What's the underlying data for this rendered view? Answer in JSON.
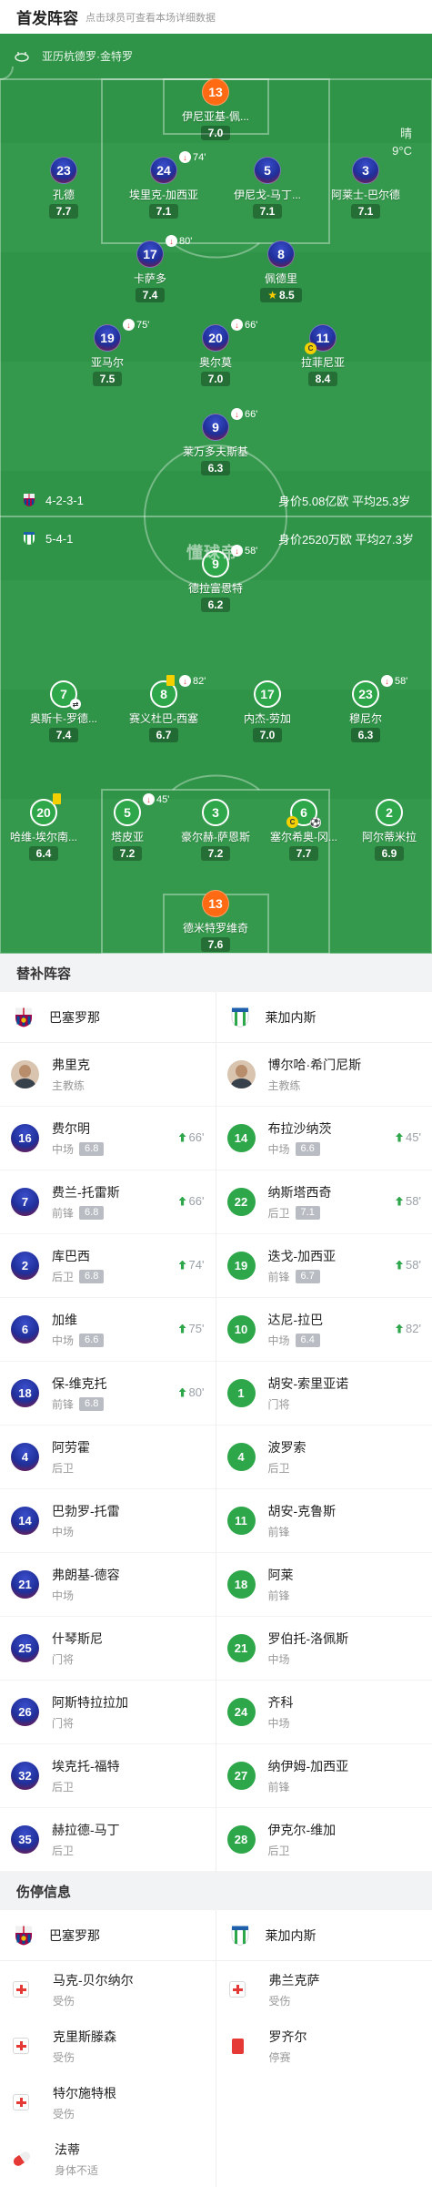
{
  "header": {
    "title": "首发阵容",
    "hint": "点击球员可查看本场详细数据"
  },
  "match": {
    "stadium": "亚历杭德罗·金特罗",
    "weather": "晴",
    "temperature": "9°C",
    "watermark": "懂球帝"
  },
  "teams": {
    "barca": {
      "name": "巴塞罗那",
      "formation": "4-2-3-1",
      "value": "身价5.08亿欧",
      "avg_age": "平均25.3岁"
    },
    "leganes": {
      "name": "莱加内斯",
      "formation": "5-4-1",
      "value": "身价2520万欧",
      "avg_age": "平均27.3岁"
    }
  },
  "lineup_barca": [
    {
      "num": "13",
      "name": "伊尼亚基-佩...",
      "rating": "7.0",
      "kit": "gk-barca"
    },
    {
      "num": "23",
      "name": "孔德",
      "rating": "7.7",
      "kit": "barca"
    },
    {
      "num": "24",
      "name": "埃里克-加西亚",
      "rating": "7.1",
      "kit": "barca",
      "sub": "74'"
    },
    {
      "num": "5",
      "name": "伊尼戈-马丁...",
      "rating": "7.1",
      "kit": "barca"
    },
    {
      "num": "3",
      "name": "阿莱士-巴尔德",
      "rating": "7.1",
      "kit": "barca"
    },
    {
      "num": "17",
      "name": "卡萨多",
      "rating": "7.4",
      "kit": "barca",
      "sub": "80'"
    },
    {
      "num": "8",
      "name": "佩德里",
      "rating": "8.5",
      "kit": "barca",
      "star": true
    },
    {
      "num": "19",
      "name": "亚马尔",
      "rating": "7.5",
      "kit": "barca",
      "sub": "75'"
    },
    {
      "num": "20",
      "name": "奥尔莫",
      "rating": "7.0",
      "kit": "barca",
      "sub": "66'"
    },
    {
      "num": "11",
      "name": "拉菲尼亚",
      "rating": "8.4",
      "kit": "barca",
      "captain": "C"
    },
    {
      "num": "9",
      "name": "莱万多夫斯基",
      "rating": "6.3",
      "kit": "barca",
      "sub": "66'"
    }
  ],
  "lineup_leganes": [
    {
      "num": "9",
      "name": "德拉富恩特",
      "rating": "6.2",
      "kit": "leg",
      "sub": "58'"
    },
    {
      "num": "7",
      "name": "奥斯卡-罗德...",
      "rating": "7.4",
      "kit": "leg",
      "sub_icon": true
    },
    {
      "num": "8",
      "name": "赛义杜巴-西塞",
      "rating": "6.7",
      "kit": "leg",
      "sub": "82'",
      "yellow": true
    },
    {
      "num": "17",
      "name": "内杰-劳加",
      "rating": "7.0",
      "kit": "leg"
    },
    {
      "num": "23",
      "name": "穆尼尔",
      "rating": "6.3",
      "kit": "leg",
      "sub": "58'"
    },
    {
      "num": "20",
      "name": "哈维-埃尔南...",
      "rating": "6.4",
      "kit": "leg",
      "yellow": true
    },
    {
      "num": "5",
      "name": "塔皮亚",
      "rating": "7.2",
      "kit": "leg",
      "sub": "45'"
    },
    {
      "num": "3",
      "name": "豪尔赫-萨恩斯",
      "rating": "7.2",
      "kit": "leg"
    },
    {
      "num": "6",
      "name": "塞尔希奥-冈...",
      "rating": "7.7",
      "kit": "leg",
      "captain": "C",
      "goal": true
    },
    {
      "num": "2",
      "name": "阿尔蒂米拉",
      "rating": "6.9",
      "kit": "leg"
    },
    {
      "num": "13",
      "name": "德米特罗维奇",
      "rating": "7.6",
      "kit": "gk-leg"
    }
  ],
  "subs": {
    "title": "替补阵容",
    "barca_coach": {
      "name": "弗里克",
      "role": "主教练"
    },
    "leganes_coach": {
      "name": "博尔哈·希门尼斯",
      "role": "主教练"
    },
    "barca": [
      {
        "num": "16",
        "name": "费尔明",
        "pos": "中场",
        "rating": "6.8",
        "in": "66'"
      },
      {
        "num": "7",
        "name": "费兰-托雷斯",
        "pos": "前锋",
        "rating": "6.8",
        "in": "66'"
      },
      {
        "num": "2",
        "name": "库巴西",
        "pos": "后卫",
        "rating": "6.8",
        "in": "74'"
      },
      {
        "num": "6",
        "name": "加维",
        "pos": "中场",
        "rating": "6.6",
        "in": "75'"
      },
      {
        "num": "18",
        "name": "保-维克托",
        "pos": "前锋",
        "rating": "6.8",
        "in": "80'"
      },
      {
        "num": "4",
        "name": "阿劳霍",
        "pos": "后卫"
      },
      {
        "num": "14",
        "name": "巴勃罗-托雷",
        "pos": "中场"
      },
      {
        "num": "21",
        "name": "弗朗基-德容",
        "pos": "中场"
      },
      {
        "num": "25",
        "name": "什琴斯尼",
        "pos": "门将"
      },
      {
        "num": "26",
        "name": "阿斯特拉拉加",
        "pos": "门将"
      },
      {
        "num": "32",
        "name": "埃克托-福特",
        "pos": "后卫"
      },
      {
        "num": "35",
        "name": "赫拉德-马丁",
        "pos": "后卫"
      }
    ],
    "leganes": [
      {
        "num": "14",
        "name": "布拉沙纳茨",
        "pos": "中场",
        "rating": "6.6",
        "in": "45'"
      },
      {
        "num": "22",
        "name": "纳斯塔西奇",
        "pos": "后卫",
        "rating": "7.1",
        "in": "58'"
      },
      {
        "num": "19",
        "name": "迭戈-加西亚",
        "pos": "前锋",
        "rating": "6.7",
        "in": "58'"
      },
      {
        "num": "10",
        "name": "达尼-拉巴",
        "pos": "中场",
        "rating": "6.4",
        "in": "82'"
      },
      {
        "num": "1",
        "name": "胡安-索里亚诺",
        "pos": "门将"
      },
      {
        "num": "4",
        "name": "波罗索",
        "pos": "后卫"
      },
      {
        "num": "11",
        "name": "胡安-克鲁斯",
        "pos": "前锋"
      },
      {
        "num": "18",
        "name": "阿莱",
        "pos": "前锋"
      },
      {
        "num": "21",
        "name": "罗伯托-洛佩斯",
        "pos": "中场"
      },
      {
        "num": "24",
        "name": "齐科",
        "pos": "中场"
      },
      {
        "num": "27",
        "name": "纳伊姆-加西亚",
        "pos": "前锋"
      },
      {
        "num": "28",
        "name": "伊克尔-维加",
        "pos": "后卫"
      }
    ]
  },
  "injuries": {
    "title": "伤停信息",
    "barca": [
      {
        "name": "马克-贝尔纳尔",
        "status": "受伤",
        "icon": "medical-kit-icon"
      },
      {
        "name": "克里斯滕森",
        "status": "受伤",
        "icon": "medical-kit-icon"
      },
      {
        "name": "特尔施特根",
        "status": "受伤",
        "icon": "medical-kit-icon"
      },
      {
        "name": "法蒂",
        "status": "身体不适",
        "icon": "pill-icon"
      }
    ],
    "leganes": [
      {
        "name": "弗兰克萨",
        "status": "受伤",
        "icon": "medical-kit-icon"
      },
      {
        "name": "罗齐尔",
        "status": "停赛",
        "icon": "red-card-icon"
      }
    ]
  }
}
